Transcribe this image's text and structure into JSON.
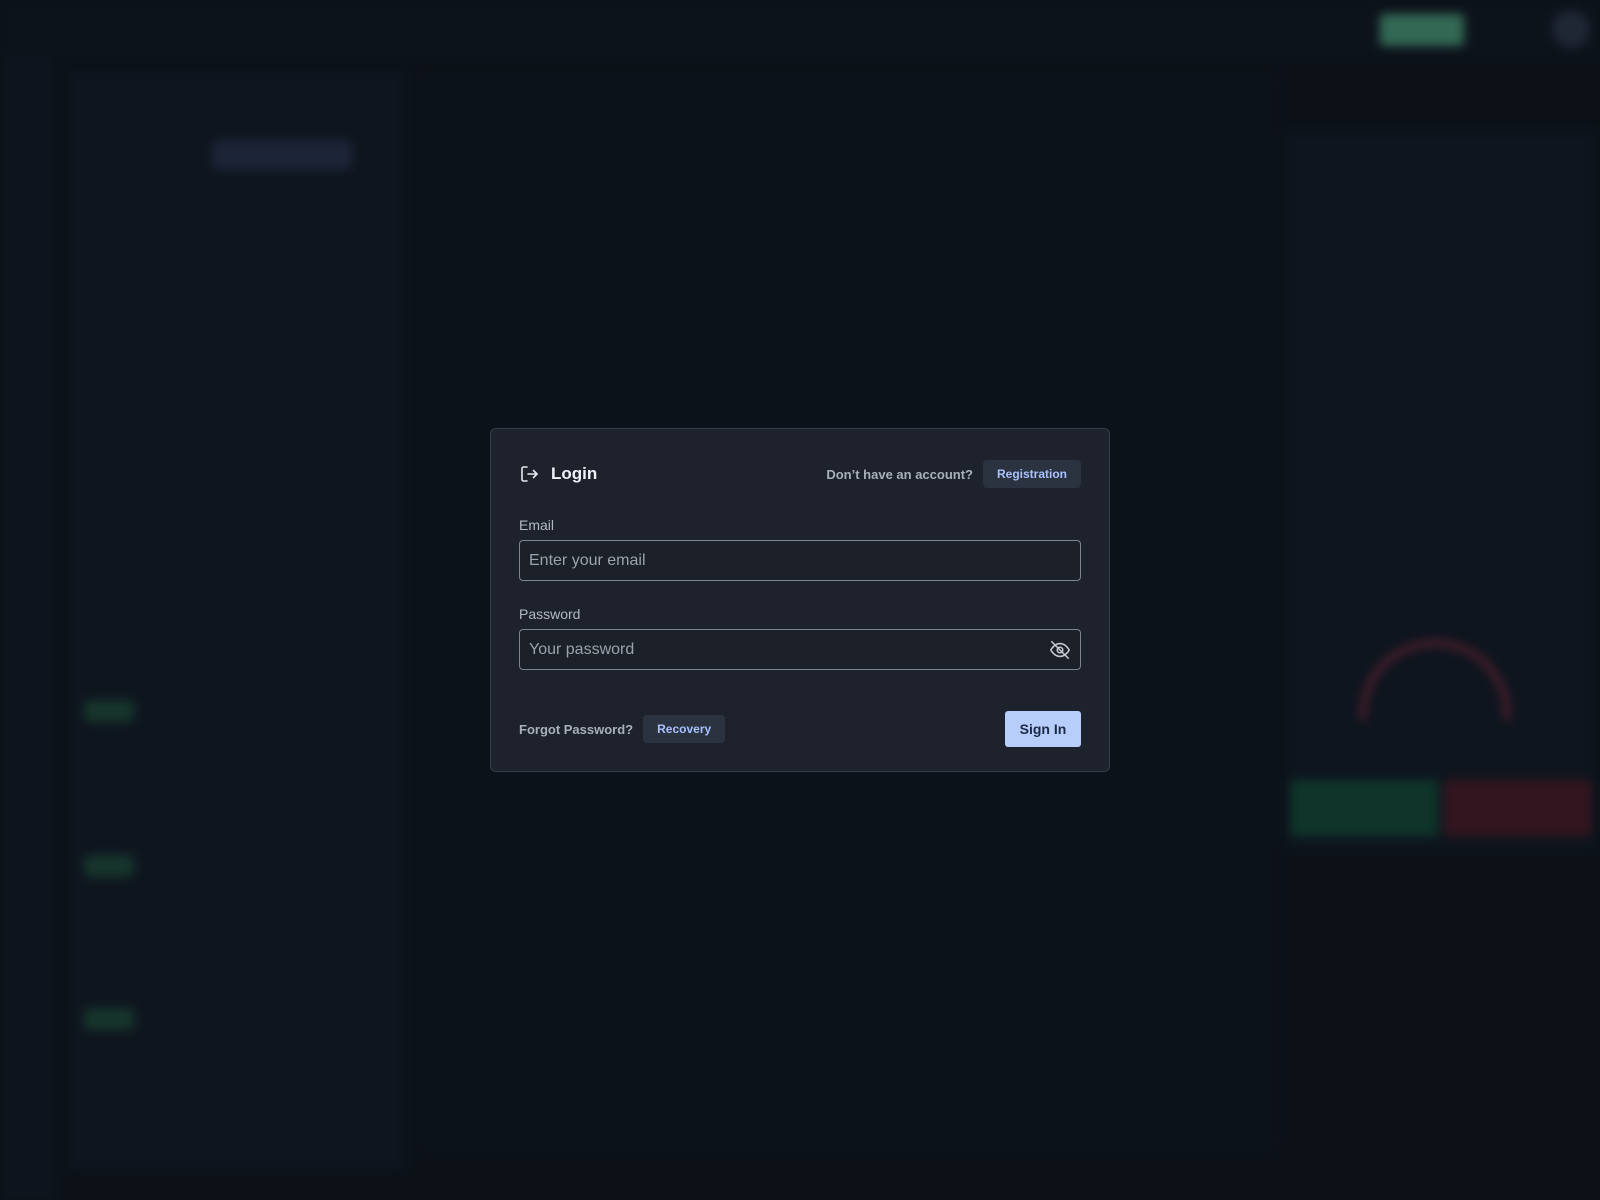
{
  "modal": {
    "title": "Login",
    "icon": "login-icon",
    "no_account_text": "Don’t have an account?",
    "registration_label": "Registration",
    "email": {
      "label": "Email",
      "placeholder": "Enter your email",
      "value": ""
    },
    "password": {
      "label": "Password",
      "placeholder": "Your password",
      "value": "",
      "toggle_icon": "eye-off-icon"
    },
    "forgot_text": "Forgot Password?",
    "recovery_label": "Recovery",
    "sign_in_label": "Sign In"
  },
  "colors": {
    "background": "#0e131b",
    "modal_bg": "#1d222c",
    "accent": "#b7cdfa",
    "link_blue": "#a8c1ff"
  }
}
